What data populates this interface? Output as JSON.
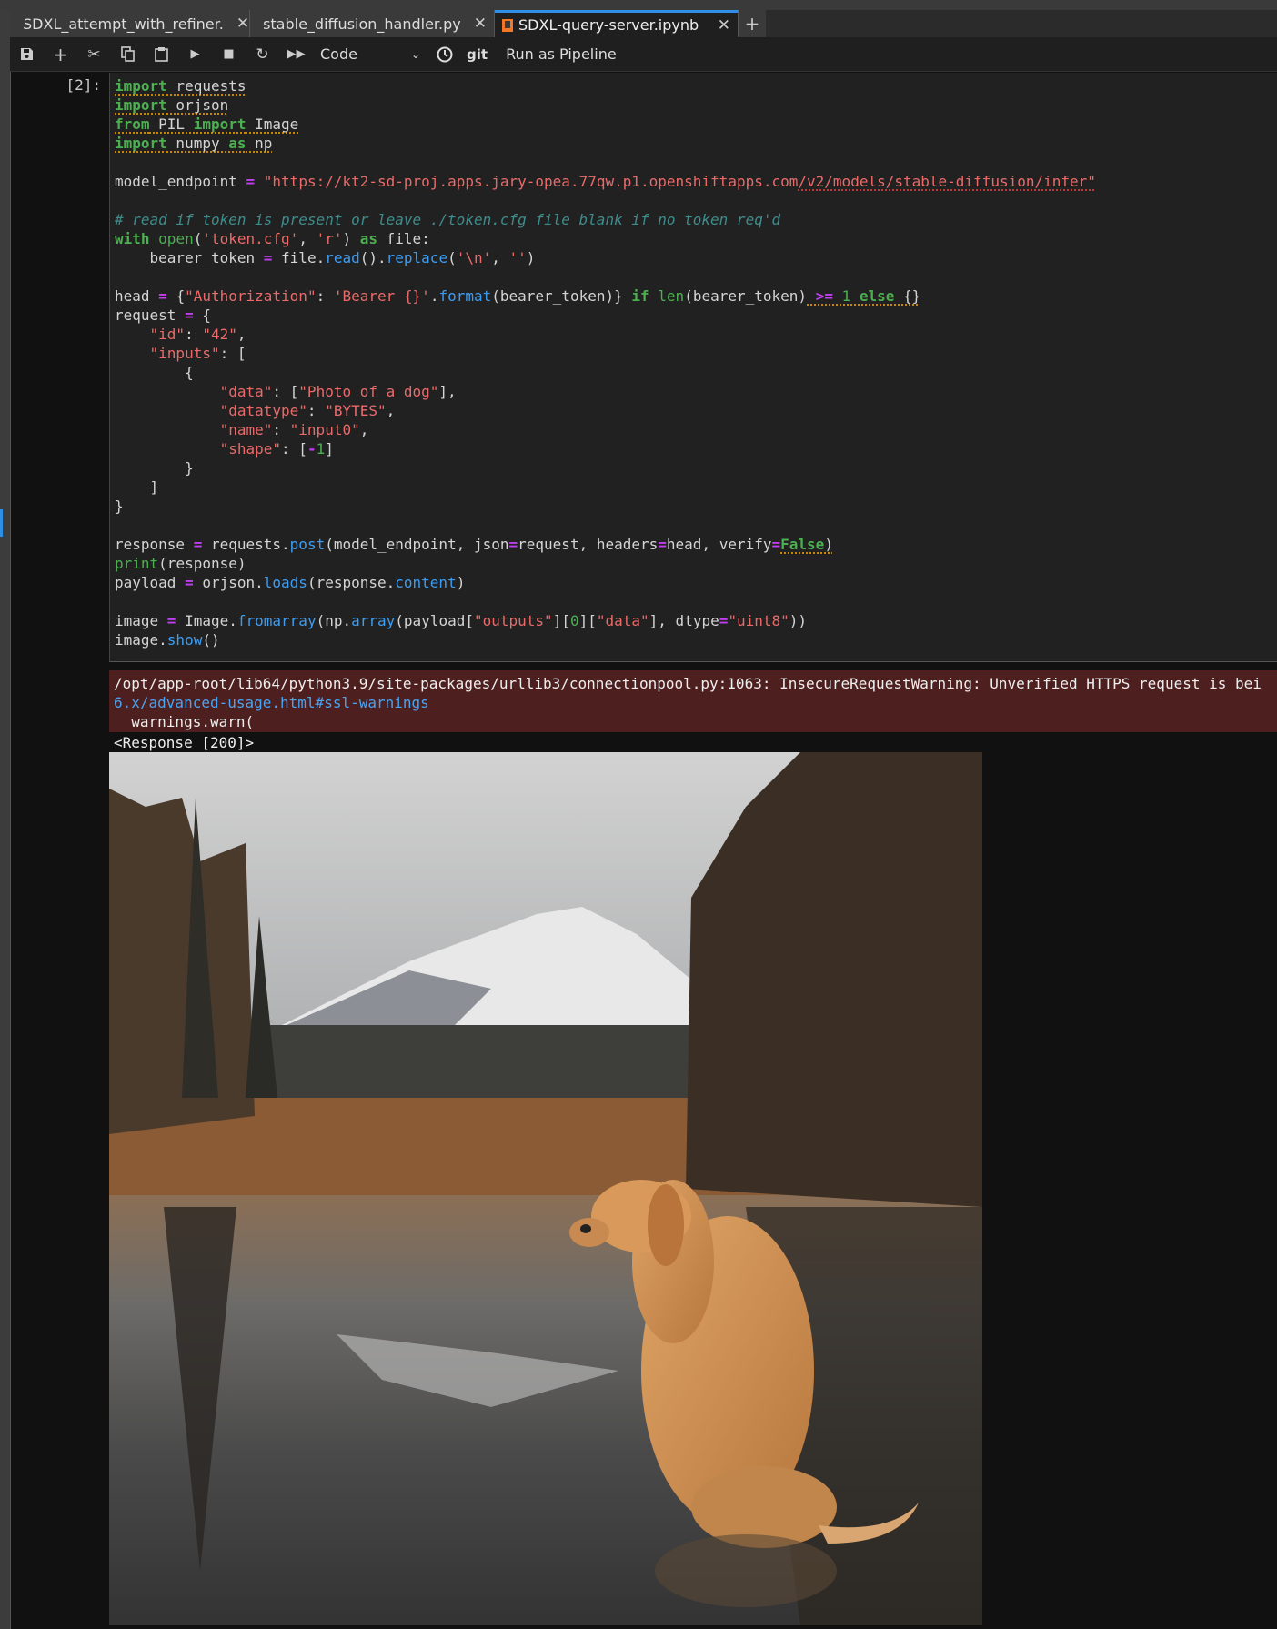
{
  "tabs": [
    {
      "label": "SDXL_attempt_with_refiner.",
      "icon": "notebook-icon",
      "active": false
    },
    {
      "label": "stable_diffusion_handler.py",
      "icon": "python-icon",
      "active": false
    },
    {
      "label": "SDXL-query-server.ipynb",
      "icon": "notebook-icon",
      "active": true
    }
  ],
  "toolbar": {
    "cell_type": "Code",
    "git_label": "git",
    "pipeline_label": "Run as Pipeline"
  },
  "cell": {
    "prompt": "[2]:",
    "lines": [
      [
        [
          "kw u",
          "import"
        ],
        [
          "u",
          " requests"
        ]
      ],
      [
        [
          "kw u",
          "import"
        ],
        [
          "u",
          " orjson"
        ]
      ],
      [
        [
          "kw u",
          "from"
        ],
        [
          "u",
          " PIL "
        ],
        [
          "kw u",
          "import"
        ],
        [
          "u",
          " Image"
        ]
      ],
      [
        [
          "kw u",
          "import"
        ],
        [
          "u",
          " numpy "
        ],
        [
          "kw u",
          "as"
        ],
        [
          "u",
          " np"
        ]
      ],
      [],
      [
        [
          "",
          "model_endpoint "
        ],
        [
          "op",
          "="
        ],
        [
          "",
          " "
        ],
        [
          "str",
          "\"https://kt2-sd-proj.apps.jary-opea.77qw.p1.openshiftapps.com"
        ],
        [
          "str ur",
          "/v2/models/stable-diffusion/infer\""
        ]
      ],
      [],
      [
        [
          "cm",
          "# read if token is present or leave ./token.cfg file blank if no token req'd"
        ]
      ],
      [
        [
          "kw",
          "with"
        ],
        [
          "",
          " "
        ],
        [
          "bi",
          "open"
        ],
        [
          "",
          "("
        ],
        [
          "str",
          "'token.cfg'"
        ],
        [
          "",
          ", "
        ],
        [
          "str",
          "'r'"
        ],
        [
          "",
          ") "
        ],
        [
          "kw",
          "as"
        ],
        [
          "",
          " file:"
        ]
      ],
      [
        [
          "",
          "    bearer_token "
        ],
        [
          "op",
          "="
        ],
        [
          "",
          " file."
        ],
        [
          "fn",
          "read"
        ],
        [
          "",
          "()."
        ],
        [
          "fn",
          "replace"
        ],
        [
          "",
          "("
        ],
        [
          "str",
          "'\\n'"
        ],
        [
          "",
          ", "
        ],
        [
          "str",
          "''"
        ],
        [
          "",
          ")"
        ]
      ],
      [],
      [
        [
          "",
          "head "
        ],
        [
          "op",
          "="
        ],
        [
          "",
          " {"
        ],
        [
          "str",
          "\"Authorization\""
        ],
        [
          "",
          ": "
        ],
        [
          "str",
          "'Bearer {}'"
        ],
        [
          "",
          "."
        ],
        [
          "fn",
          "format"
        ],
        [
          "",
          "(bearer_token)} "
        ],
        [
          "kw",
          "if"
        ],
        [
          "",
          " "
        ],
        [
          "bi",
          "len"
        ],
        [
          "",
          "(bearer_token)"
        ],
        [
          "op u",
          " >="
        ],
        [
          "num u",
          " 1"
        ],
        [
          "kw u",
          " else"
        ],
        [
          "u",
          " {}"
        ]
      ],
      [
        [
          "",
          "request "
        ],
        [
          "op",
          "="
        ],
        [
          "",
          " {"
        ]
      ],
      [
        [
          "",
          "    "
        ],
        [
          "str",
          "\"id\""
        ],
        [
          "",
          ": "
        ],
        [
          "str",
          "\"42\""
        ],
        [
          "",
          ","
        ]
      ],
      [
        [
          "",
          "    "
        ],
        [
          "str",
          "\"inputs\""
        ],
        [
          "",
          ": ["
        ]
      ],
      [
        [
          "",
          "        {"
        ]
      ],
      [
        [
          "",
          "            "
        ],
        [
          "str",
          "\"data\""
        ],
        [
          "",
          ": ["
        ],
        [
          "str",
          "\"Photo of a dog\""
        ],
        [
          "",
          "],"
        ]
      ],
      [
        [
          "",
          "            "
        ],
        [
          "str",
          "\"datatype\""
        ],
        [
          "",
          ": "
        ],
        [
          "str",
          "\"BYTES\""
        ],
        [
          "",
          ","
        ]
      ],
      [
        [
          "",
          "            "
        ],
        [
          "str",
          "\"name\""
        ],
        [
          "",
          ": "
        ],
        [
          "str",
          "\"input0\""
        ],
        [
          "",
          ","
        ]
      ],
      [
        [
          "",
          "            "
        ],
        [
          "str",
          "\"shape\""
        ],
        [
          "",
          ": ["
        ],
        [
          "op",
          "-"
        ],
        [
          "num",
          "1"
        ],
        [
          "",
          "]"
        ]
      ],
      [
        [
          "",
          "        }"
        ]
      ],
      [
        [
          "",
          "    ]"
        ]
      ],
      [
        [
          "",
          "}"
        ]
      ],
      [],
      [
        [
          "",
          "response "
        ],
        [
          "op",
          "="
        ],
        [
          "",
          " requests."
        ],
        [
          "fn",
          "post"
        ],
        [
          "",
          "(model_endpoint, json"
        ],
        [
          "op",
          "="
        ],
        [
          "",
          "request, headers"
        ],
        [
          "op",
          "="
        ],
        [
          "",
          "head, verify"
        ],
        [
          "op",
          "="
        ],
        [
          "kw u",
          "False"
        ],
        [
          "u",
          ")"
        ]
      ],
      [
        [
          "bi",
          "print"
        ],
        [
          "",
          "(response)"
        ]
      ],
      [
        [
          "",
          "payload "
        ],
        [
          "op",
          "="
        ],
        [
          "",
          " orjson."
        ],
        [
          "fn",
          "loads"
        ],
        [
          "",
          "(response."
        ],
        [
          "fn",
          "content"
        ],
        [
          "",
          ")"
        ]
      ],
      [],
      [
        [
          "",
          "image "
        ],
        [
          "op",
          "="
        ],
        [
          "",
          " Image."
        ],
        [
          "fn",
          "fromarray"
        ],
        [
          "",
          "(np."
        ],
        [
          "fn",
          "array"
        ],
        [
          "",
          "(payload["
        ],
        [
          "str",
          "\"outputs\""
        ],
        [
          "",
          "]["
        ],
        [
          "num",
          "0"
        ],
        [
          "",
          "]["
        ],
        [
          "str",
          "\"data\""
        ],
        [
          "",
          "], dtype"
        ],
        [
          "op",
          "="
        ],
        [
          "str",
          "\"uint8\""
        ],
        [
          "",
          "))"
        ]
      ],
      [
        [
          "",
          "image."
        ],
        [
          "fn",
          "show"
        ],
        [
          "",
          "()"
        ]
      ]
    ]
  },
  "output": {
    "warning_line1": "/opt/app-root/lib64/python3.9/site-packages/urllib3/connectionpool.py:1063: InsecureRequestWarning: Unverified HTTPS request is bei",
    "warning_link": "6.x/advanced-usage.html#ssl-warnings",
    "warning_line3": "  warnings.warn(",
    "response": "<Response [200]>",
    "image_subject": "generated-dog-by-lake-image"
  },
  "colors": {
    "accent": "#2f8fe6",
    "keyword": "#4caf50",
    "string": "#ea6a6a",
    "warning_bg": "#4e1f1f"
  }
}
